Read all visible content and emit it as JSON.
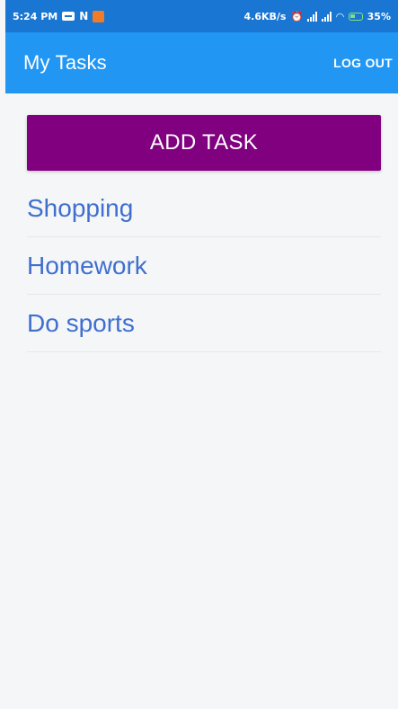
{
  "status_bar": {
    "time": "5:24 PM",
    "notification_icons": [
      "message-icon",
      "n-icon",
      "app-icon"
    ],
    "network_speed": "4.6KB/s",
    "battery": "35%",
    "colors": {
      "background": "#1976d2",
      "battery": "#7fe07f",
      "app_icon": "#f07c2a"
    }
  },
  "app_bar": {
    "title": "My Tasks",
    "logout_label": "LOG OUT",
    "color": "#2196f3"
  },
  "main": {
    "add_task_label": "ADD TASK",
    "add_task_color": "#800080",
    "tasks": [
      {
        "label": "Shopping"
      },
      {
        "label": "Homework"
      },
      {
        "label": "Do sports"
      }
    ],
    "task_text_color": "#3f6fcf"
  }
}
